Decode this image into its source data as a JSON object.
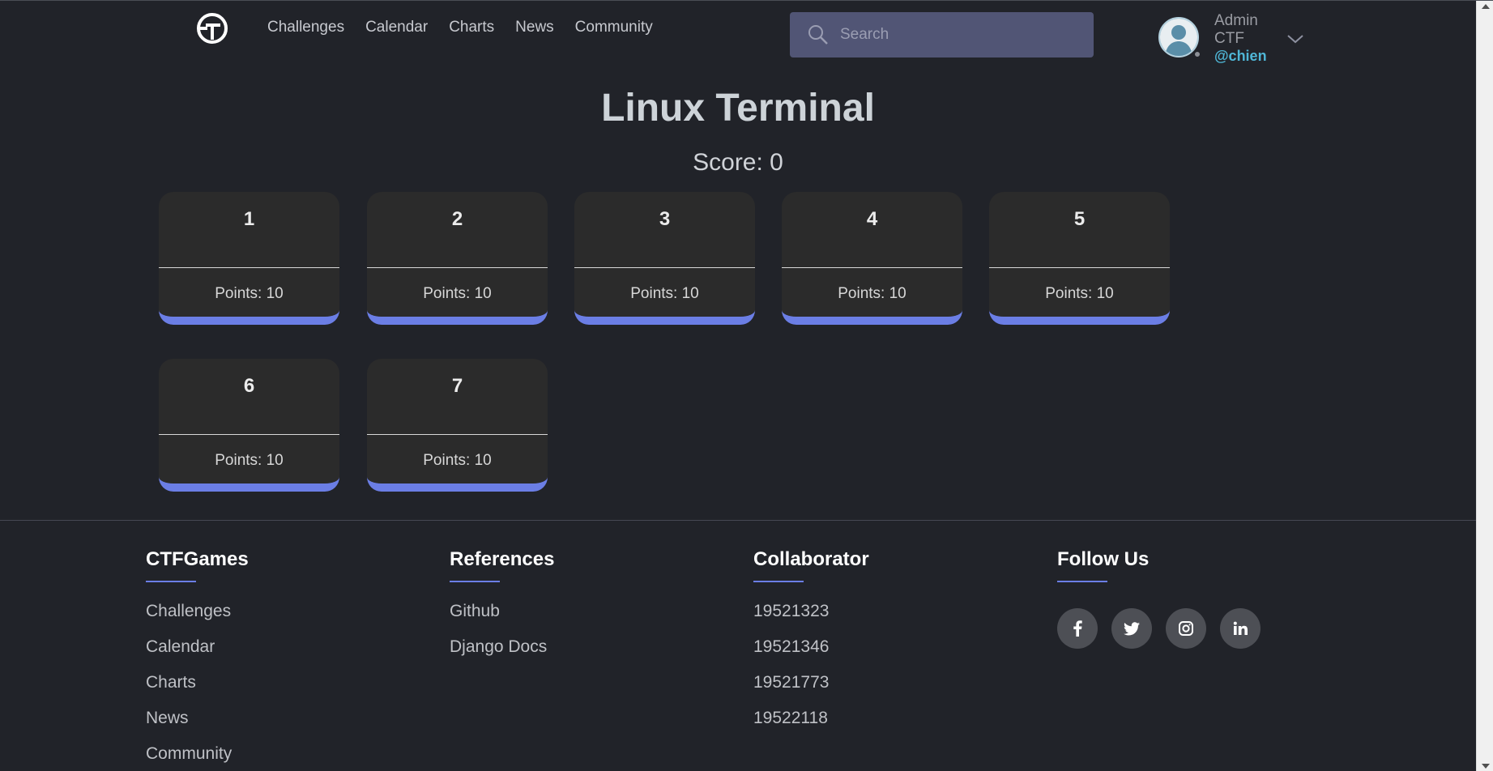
{
  "nav": {
    "logo": "ctf-logo-icon",
    "items": [
      "Challenges",
      "Calendar",
      "Charts",
      "News",
      "Community"
    ]
  },
  "search": {
    "placeholder": "Search",
    "icon": "search-icon"
  },
  "user": {
    "name": "Admin CTF",
    "handle": "@chien",
    "status_color": "#8c8f96"
  },
  "main": {
    "title": "Linux Terminal",
    "score": "Score: 0",
    "challenges": [
      {
        "number": "1",
        "points": "Points: 10"
      },
      {
        "number": "2",
        "points": "Points: 10"
      },
      {
        "number": "3",
        "points": "Points: 10"
      },
      {
        "number": "4",
        "points": "Points: 10"
      },
      {
        "number": "5",
        "points": "Points: 10"
      },
      {
        "number": "6",
        "points": "Points: 10"
      },
      {
        "number": "7",
        "points": "Points: 10"
      }
    ]
  },
  "footer": {
    "ctfgames": {
      "title": "CTFGames",
      "links": [
        "Challenges",
        "Calendar",
        "Charts",
        "News",
        "Community"
      ]
    },
    "references": {
      "title": "References",
      "links": [
        "Github",
        "Django Docs"
      ]
    },
    "collaborator": {
      "title": "Collaborator",
      "links": [
        "19521323",
        "19521346",
        "19521773",
        "19522118"
      ]
    },
    "follow": {
      "title": "Follow Us",
      "socials": [
        {
          "icon": "facebook-icon",
          "glyph": "f"
        },
        {
          "icon": "twitter-icon",
          "glyph": "🐦"
        },
        {
          "icon": "instagram-icon",
          "glyph": "◎"
        },
        {
          "icon": "linkedin-icon",
          "glyph": "in"
        }
      ]
    }
  },
  "colors": {
    "accent": "#6b7ee5",
    "background": "#212329",
    "card": "#2b2b2b",
    "search_bg": "#515575",
    "handle": "#4fb6d6"
  }
}
